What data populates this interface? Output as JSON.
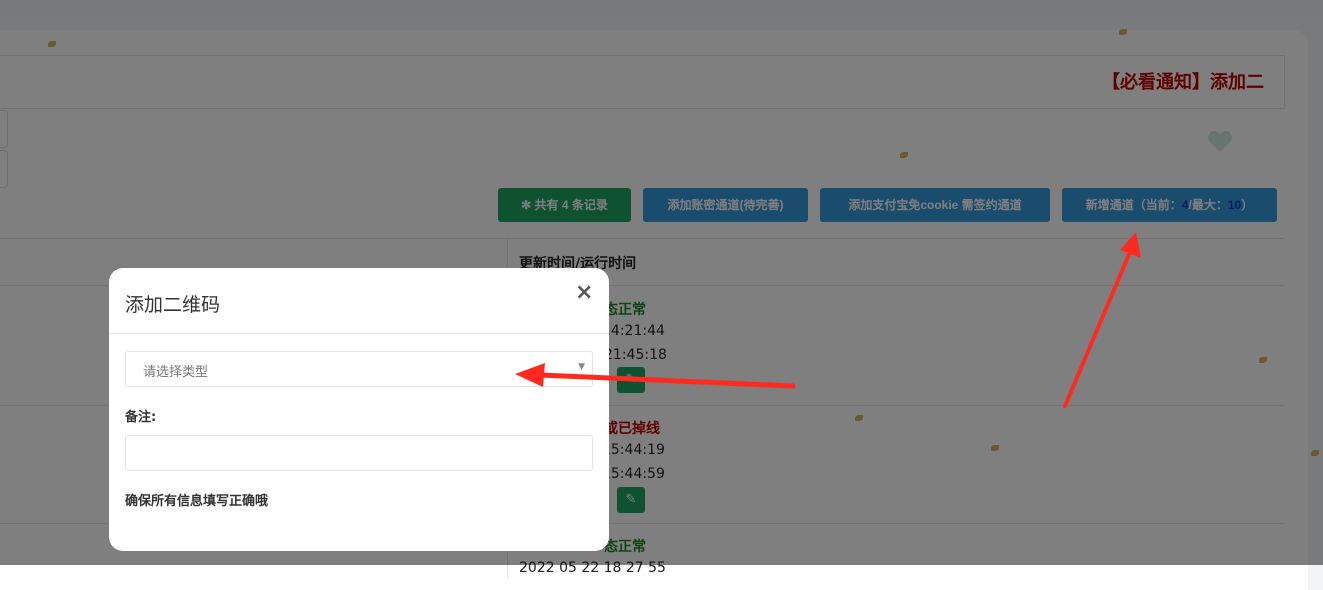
{
  "notice": {
    "text": "【必看通知】添加二"
  },
  "toolbar": {
    "record_count_prefix": "✻ 共有 ",
    "record_count": "4",
    "record_count_suffix": " 条记录",
    "add_password_channel": "添加账密通道(待完善)",
    "add_alipay_channel": "添加支付宝免cookie 需签约通道",
    "new_channel_prefix": "新增通道（当前：",
    "new_channel_current": "4",
    "new_channel_mid": "/最大：",
    "new_channel_max": "10",
    "new_channel_suffix": "）"
  },
  "table": {
    "header_time": "更新时间/运行时间",
    "rows": [
      {
        "status": "态正常",
        "time1": "14:21:44",
        "time2": "21:45:18"
      },
      {
        "status": "或已掉线",
        "time1": "15:44:19",
        "time2": "15:44:59"
      },
      {
        "status": "态正常",
        "time1": "2022 05 22 18 27 55"
      }
    ]
  },
  "modal": {
    "title": "添加二维码",
    "close": "×",
    "type_placeholder": "请选择类型",
    "remark_label": "备注:",
    "confirm_note": "确保所有信息填写正确哦"
  },
  "colors": {
    "green": "#1fa463",
    "blue": "#3598dc",
    "notice_red": "#c30000",
    "arrow_red": "#ff2a1f"
  },
  "icons": {
    "edit": "pencil-icon",
    "close": "close-icon",
    "heart": "heart-icon",
    "caret": "caret-down-icon"
  }
}
